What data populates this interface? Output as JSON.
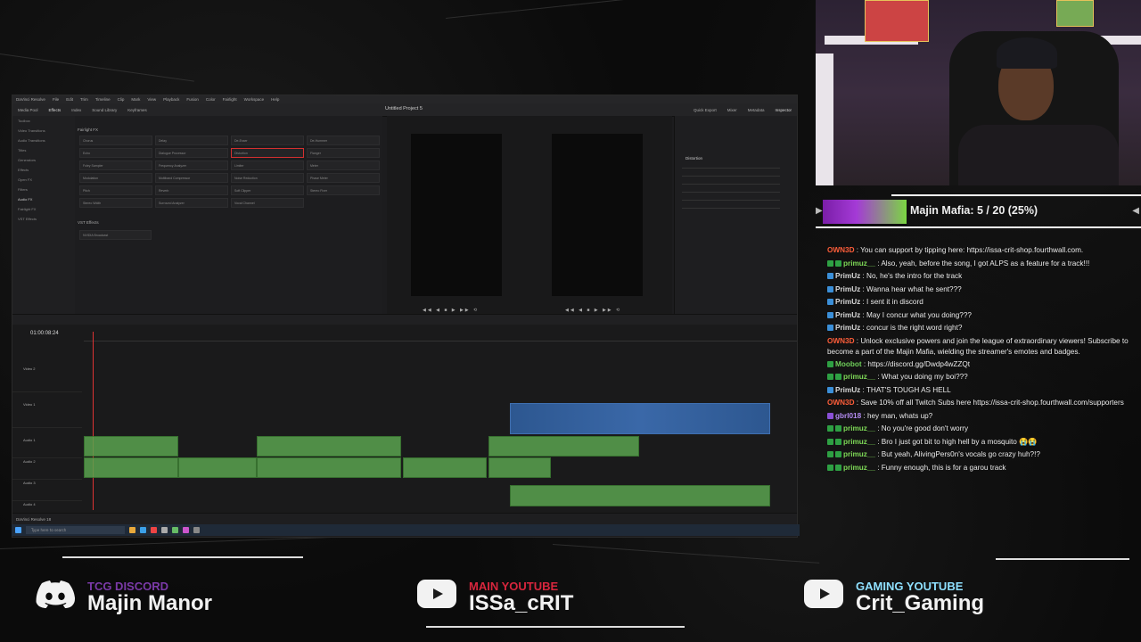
{
  "resolve": {
    "title": "Untitled Project 5",
    "menu": [
      "DaVinci Resolve",
      "File",
      "Edit",
      "Trim",
      "Timeline",
      "Clip",
      "Mark",
      "View",
      "Playback",
      "Fusion",
      "Color",
      "Fairlight",
      "Workspace",
      "Help"
    ],
    "toolbar_left": [
      "Media Pool",
      "Effects",
      "Index",
      "Sound Library",
      "Keyframes"
    ],
    "toolbar_right": [
      "Quick Export",
      "Mixer",
      "Metadata",
      "Inspector"
    ],
    "fx_header": "Fairlight FX",
    "vst_header": "VST Effects",
    "timecode": "01:00:08:24",
    "tracks": [
      "Video 2",
      "Video 1",
      "Audio 1",
      "Audio 2",
      "Audio 3",
      "Audio 4"
    ],
    "inspector_section": "Distortion",
    "app_name": "DaVinci Resolve 18"
  },
  "taskbar": {
    "search_placeholder": "Type here to search"
  },
  "goal": {
    "label": "Majin Mafia: 5 / 20 (25%)",
    "current": 5,
    "target": 20,
    "percent": 25
  },
  "chat": [
    {
      "user": "OWN3D",
      "color": "#ff5e3a",
      "badges": [],
      "text": "You can support by tipping here: https://issa-crit-shop.fourthwall.com."
    },
    {
      "user": "primuz__",
      "color": "#7ed957",
      "badges": [
        "green",
        "green"
      ],
      "text": "Also, yeah, before the song, I got ALPS as a feature for a track!!!"
    },
    {
      "user": "PrimUz",
      "color": "#d8d8d8",
      "badges": [
        "blue"
      ],
      "text": "No, he's the intro for the track"
    },
    {
      "user": "PrimUz",
      "color": "#d8d8d8",
      "badges": [
        "blue"
      ],
      "text": "Wanna hear what he sent???"
    },
    {
      "user": "PrimUz",
      "color": "#d8d8d8",
      "badges": [
        "blue"
      ],
      "text": "I sent it in discord"
    },
    {
      "user": "PrimUz",
      "color": "#d8d8d8",
      "badges": [
        "blue"
      ],
      "text": "May I concur what you doing???"
    },
    {
      "user": "PrimUz",
      "color": "#d8d8d8",
      "badges": [
        "blue"
      ],
      "text": "concur is the right word right?"
    },
    {
      "user": "OWN3D",
      "color": "#ff5e3a",
      "badges": [],
      "text": "Unlock exclusive powers and join the league of extraordinary viewers! Subscribe to become a part of the Majin Mafia, wielding the streamer's emotes and badges.",
      "wrap": true
    },
    {
      "user": "Moobot",
      "color": "#6fcf5a",
      "badges": [
        "green"
      ],
      "text": "https://discord.gg/Dwdp4wZZQt"
    },
    {
      "user": "primuz__",
      "color": "#7ed957",
      "badges": [
        "green",
        "green"
      ],
      "text": "What you doing my boi???"
    },
    {
      "user": "PrimUz",
      "color": "#d8d8d8",
      "badges": [
        "blue"
      ],
      "text": "THAT'S TOUGH AS HELL"
    },
    {
      "user": "OWN3D",
      "color": "#ff5e3a",
      "badges": [],
      "text": "Save 10% off all Twitch Subs here https://issa-crit-shop.fourthwall.com/supporters"
    },
    {
      "user": "gbrl018",
      "color": "#b48cf2",
      "badges": [
        "purple"
      ],
      "text": "hey man, whats up?"
    },
    {
      "user": "primuz__",
      "color": "#7ed957",
      "badges": [
        "green",
        "green"
      ],
      "text": "No you're good don't worry"
    },
    {
      "user": "primuz__",
      "color": "#7ed957",
      "badges": [
        "green",
        "green"
      ],
      "text": "Bro I just got bit to high hell by a mosquito 😭😭"
    },
    {
      "user": "primuz__",
      "color": "#7ed957",
      "badges": [
        "green",
        "green"
      ],
      "text": "But yeah, AlivingPers0n's vocals go crazy huh?!?"
    },
    {
      "user": "primuz__",
      "color": "#7ed957",
      "badges": [
        "green",
        "green"
      ],
      "text": "Funny enough, this is for a garou track"
    }
  ],
  "socials": [
    {
      "sub": "TCG DISCORD",
      "sub_color": "#7b3aa8",
      "main": "Majin Manor",
      "icon": "discord-icon"
    },
    {
      "sub": "MAIN YOUTUBE",
      "sub_color": "#d7263d",
      "main": "ISSa_cRIT",
      "icon": "youtube-icon"
    },
    {
      "sub": "GAMING YOUTUBE",
      "sub_color": "#8fe0ff",
      "main": "Crit_Gaming",
      "icon": "youtube-icon"
    }
  ]
}
